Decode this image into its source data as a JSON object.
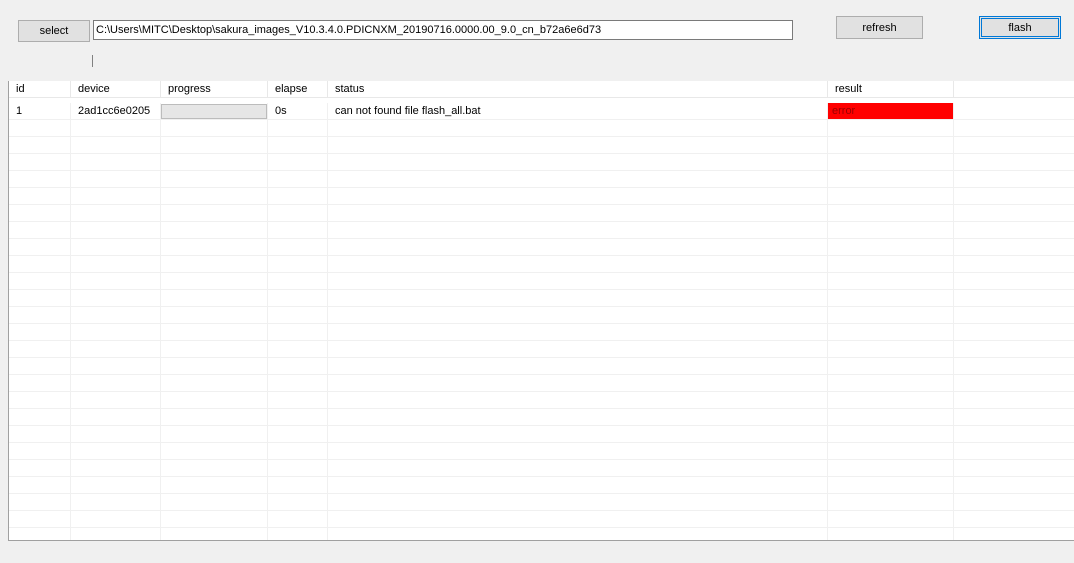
{
  "toolbar": {
    "select_label": "select",
    "path_value": "C:\\Users\\MITC\\Desktop\\sakura_images_V10.3.4.0.PDICNXM_20190716.0000.00_9.0_cn_b72a6e6d73",
    "refresh_label": "refresh",
    "flash_label": "flash"
  },
  "grid": {
    "columns": [
      "id",
      "device",
      "progress",
      "elapse",
      "status",
      "result"
    ],
    "rows": [
      {
        "id": "1",
        "device": "2ad1cc6e0205",
        "progress": 0,
        "elapse": "0s",
        "status": "can not found file flash_all.bat",
        "result": "error",
        "result_color": "#ff0000"
      }
    ]
  }
}
